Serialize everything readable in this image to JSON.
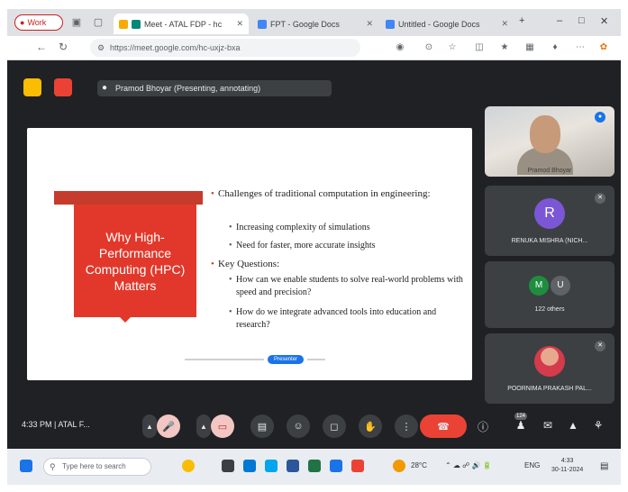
{
  "browser": {
    "profile_label": "Work",
    "tabs": [
      {
        "title": "Meet - ATAL FDP - hc",
        "active": true,
        "color": "#00897b"
      },
      {
        "title": "FPT - Google Docs",
        "active": false,
        "color": "#4285f4"
      },
      {
        "title": "Untitled - Google Docs",
        "active": false,
        "color": "#4285f4"
      }
    ],
    "new_tab": "+",
    "url": "https://meet.google.com/hc-uxjz-bxa"
  },
  "meet": {
    "presenting_label": "Pramod Bhoyar (Presenting, annotating)",
    "slide": {
      "title": "Why High-Performance Computing (HPC) Matters",
      "bullets": [
        {
          "level": 1,
          "text": "Challenges of traditional computation in engineering:"
        },
        {
          "level": 2,
          "text": "Increasing complexity of simulations"
        },
        {
          "level": 2,
          "text": "Need for faster, more accurate insights"
        },
        {
          "level": 1,
          "text": "Key Questions:"
        },
        {
          "level": 2,
          "text": "How can we enable students to solve real-world problems with speed and precision?"
        },
        {
          "level": 2,
          "text": "How do we integrate advanced tools into education and research?"
        }
      ],
      "pager_label": "Presenter"
    },
    "participants": [
      {
        "type": "video",
        "name": "Pramod Bhoyar"
      },
      {
        "type": "initial",
        "initial": "R",
        "name": "RENUKA MISHRA (NICH...",
        "color": "#7b57d6"
      },
      {
        "type": "group",
        "initials": [
          "M",
          "U"
        ],
        "name": "122 others",
        "colors": [
          "#1e8e3e",
          "#5f6368"
        ]
      },
      {
        "type": "photo",
        "name": "POORNIMA PRAKASH PAL..."
      }
    ],
    "controls": {
      "time": "4:33 PM",
      "meeting_name": "ATAL F...",
      "people_count": "124"
    }
  },
  "taskbar": {
    "search_placeholder": "Type here to search",
    "weather": "28°C",
    "time": "4:33",
    "date": "30-11-2024",
    "lang": "ENG"
  }
}
